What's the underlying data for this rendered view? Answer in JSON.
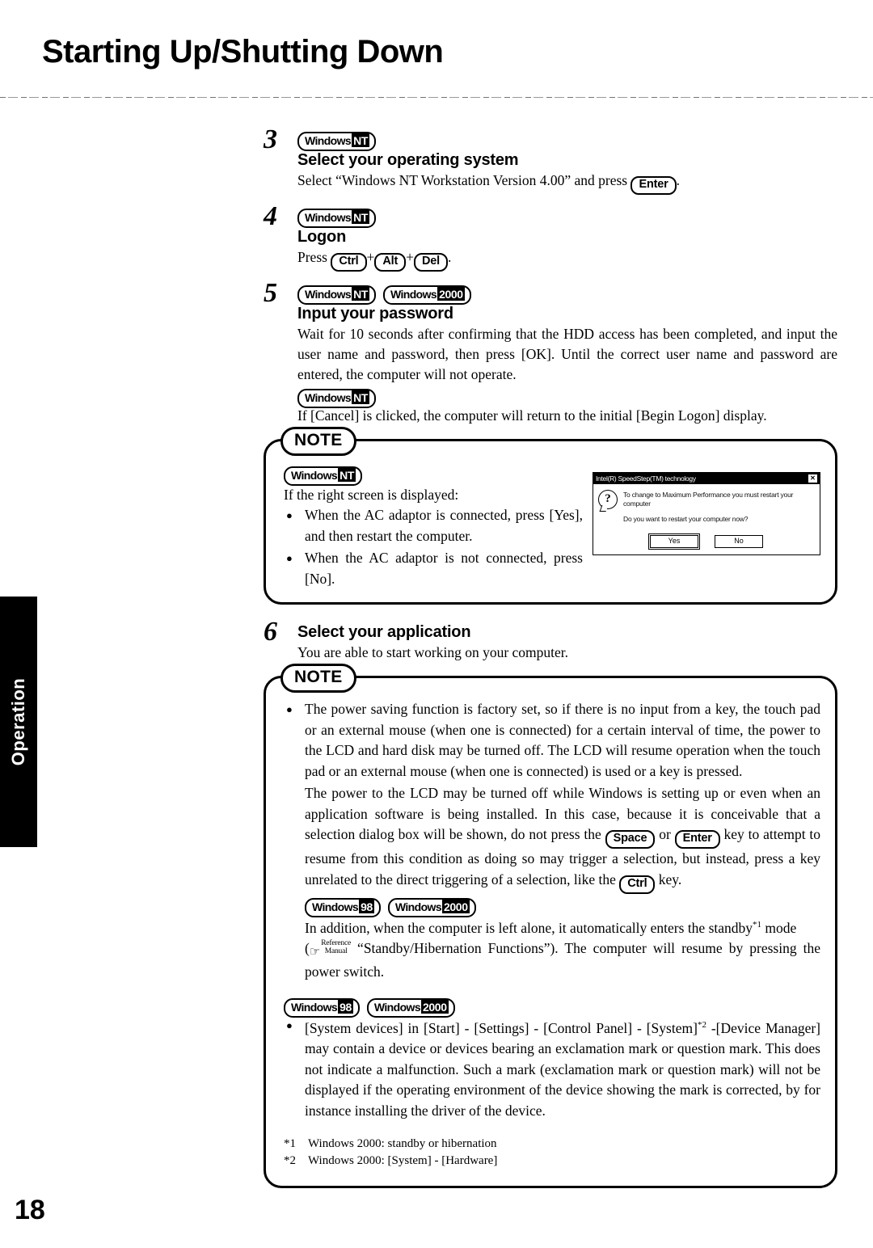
{
  "page": {
    "title": "Starting Up/Shutting Down",
    "number": "18",
    "side_tab": "Operation"
  },
  "steps": [
    {
      "number": "3",
      "badges": [
        {
          "word": "Windows",
          "version": "NT"
        }
      ],
      "heading": "Select your operating system",
      "text_before_key": "Select “Windows NT Workstation Version 4.00” and press",
      "key": "Enter",
      "text_after_key": "."
    },
    {
      "number": "4",
      "badges": [
        {
          "word": "Windows",
          "version": "NT"
        }
      ],
      "heading": "Logon",
      "press_label": "Press",
      "keys": [
        "Ctrl",
        "Alt",
        "Del"
      ],
      "plus": "+",
      "period": "."
    },
    {
      "number": "5",
      "badges": [
        {
          "word": "Windows",
          "version": "NT"
        },
        {
          "word": "Windows",
          "version": "2000"
        }
      ],
      "heading": "Input your password",
      "paragraph": "Wait for 10 seconds after confirming that the HDD access has been completed, and input the user name and password, then press [OK].   Until the correct user name and password are entered, the computer will not operate.",
      "sub_badge": {
        "word": "Windows",
        "version": "NT"
      },
      "sub_paragraph": "If [Cancel] is clicked, the computer will return to the initial [Begin Logon] display."
    },
    {
      "number": "6",
      "heading": "Select your application",
      "paragraph": "You are able to start working on your computer."
    }
  ],
  "note1": {
    "label": "NOTE",
    "badge": {
      "word": "Windows",
      "version": "NT"
    },
    "intro": "If the right screen is displayed:",
    "bullets": [
      "When the AC adaptor is connected, press [Yes], and then restart the computer.",
      "When the AC adaptor is not connected, press [No]."
    ],
    "dialog": {
      "title": "Intel(R) SpeedStep(TM) technology",
      "close_label": "✕",
      "icon": "question-mark",
      "message1": "To change to Maximum Performance  you must restart your computer",
      "message2": "Do you want to restart your computer now?",
      "buttons": [
        {
          "label": "Yes",
          "default": true
        },
        {
          "label": "No",
          "default": false
        }
      ]
    }
  },
  "note2": {
    "label": "NOTE",
    "bullet1": {
      "part1": "The power saving function is factory set, so if there is no input from a key, the touch pad or an external mouse (when one is connected) for a certain interval of time, the power to the LCD and hard disk may be turned off.  The LCD will resume operation when the touch pad or an external mouse (when one is connected) is used or a key is pressed.",
      "part2": "The power to the LCD may be turned off while Windows is setting up or even when an application software is being installed.  In this case, because it is conceivable that a selection dialog box will be shown, do not press the",
      "key1": "Space",
      "or": "or",
      "key2": "Enter",
      "part3": "key to attempt to resume from this condition as doing so may trigger a selection, but instead, press a key unrelated to the direct triggering of a selection, like the",
      "key3": "Ctrl",
      "part4": "key.",
      "badges": [
        {
          "word": "Windows",
          "version": "98"
        },
        {
          "word": "Windows",
          "version": "2000"
        }
      ],
      "part5_a": "In addition, when the computer is left alone, it automatically enters the standby",
      "footnote_ref1": "*1",
      "part5_b": " mode",
      "part6_open": "(",
      "refman_line1": "Reference",
      "refman_line2": "Manual",
      "part6_rest": "“Standby/Hibernation Functions”).  The computer will resume by pressing the power switch."
    },
    "bullet2": {
      "badges": [
        {
          "word": "Windows",
          "version": "98"
        },
        {
          "word": "Windows",
          "version": "2000"
        }
      ],
      "text_a": "[System devices] in [Start] - [Settings] - [Control Panel] - [System]",
      "footnote_ref2": "*2",
      "text_b": " -[Device Manager] may contain a device or devices bearing an exclamation mark or question mark.  This does not indicate a malfunction.  Such a mark (exclamation mark or question mark) will not be displayed if the operating environment of the device showing the mark is corrected, by for instance installing the driver of the device."
    },
    "footnotes": [
      {
        "mark": "*1",
        "text": "Windows 2000: standby or hibernation"
      },
      {
        "mark": "*2",
        "text": "Windows 2000: [System] - [Hardware]"
      }
    ]
  }
}
